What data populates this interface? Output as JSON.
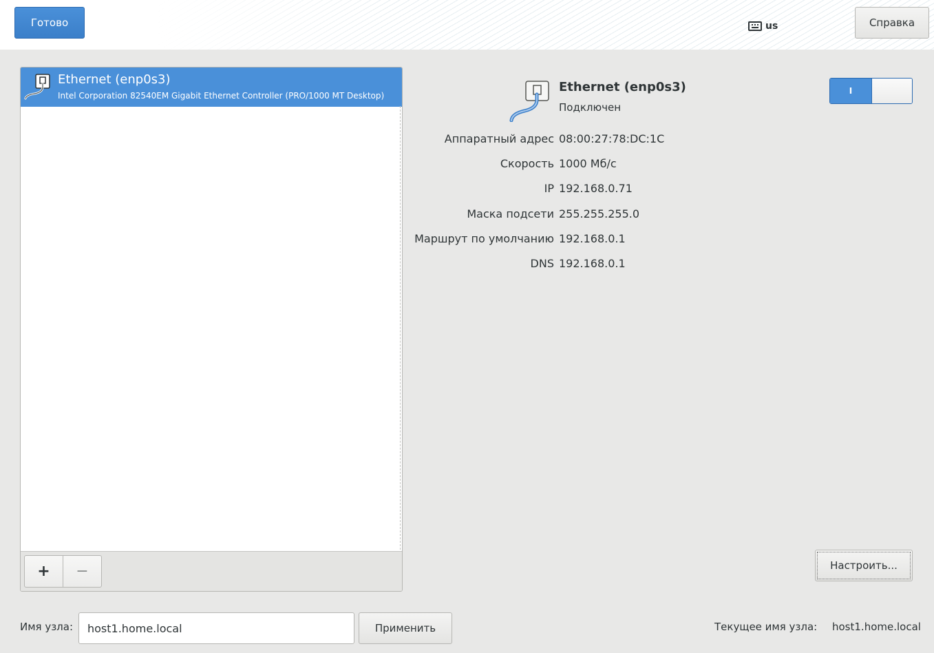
{
  "header": {
    "done_label": "Готово",
    "keyboard_layout": "us",
    "help_label": "Справка"
  },
  "connections": {
    "items": [
      {
        "title": "Ethernet (enp0s3)",
        "subtitle": "Intel Corporation 82540EM Gigabit Ethernet Controller (PRO/1000 MT Desktop)",
        "icon": "wired-network-icon",
        "selected": true
      }
    ],
    "add_label": "+",
    "remove_label": "−"
  },
  "detail": {
    "title": "Ethernet (enp0s3)",
    "status": "Подключен",
    "icon": "wired-network-icon",
    "toggle_on_label": "I",
    "toggle_state": "on",
    "properties": [
      {
        "label": "Аппаратный адрес",
        "value": "08:00:27:78:DC:1C"
      },
      {
        "label": "Скорость",
        "value": "1000 Мб/с"
      },
      {
        "label": "IP",
        "value": "192.168.0.71"
      },
      {
        "label": "Маска подсети",
        "value": "255.255.255.0"
      },
      {
        "label": "Маршрут по умолчанию",
        "value": "192.168.0.1"
      },
      {
        "label": "DNS",
        "value": "192.168.0.1"
      }
    ],
    "configure_label": "Настроить..."
  },
  "hostname": {
    "label": "Имя узла:",
    "value": "host1.home.local",
    "apply_label": "Применить",
    "current_label": "Текущее имя узла:",
    "current_value": "host1.home.local"
  },
  "colors": {
    "accent": "#4a90d9",
    "background": "#e8e8e7",
    "text": "#2e3436"
  }
}
